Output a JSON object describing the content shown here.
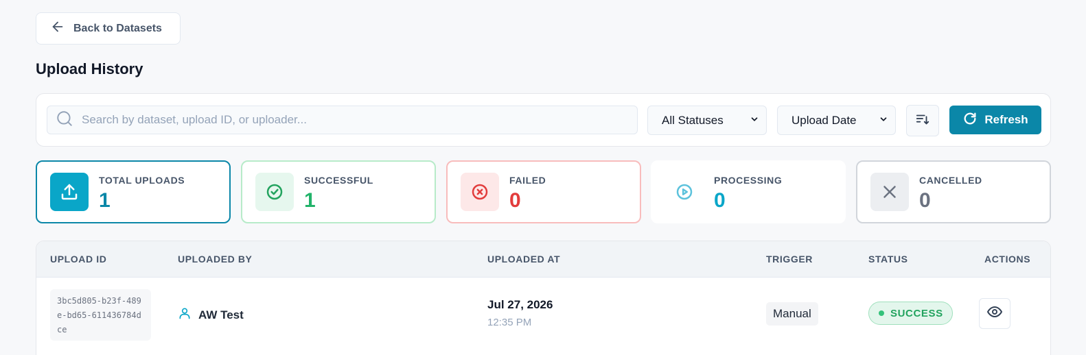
{
  "nav": {
    "back_label": "Back to Datasets"
  },
  "page": {
    "title": "Upload History"
  },
  "filters": {
    "search_placeholder": "Search by dataset, upload ID, or uploader...",
    "status_select": "All Statuses",
    "sort_select": "Upload Date",
    "refresh_label": "Refresh"
  },
  "stats": [
    {
      "label": "TOTAL UPLOADS",
      "value": "1",
      "icon": "upload-icon"
    },
    {
      "label": "SUCCESSFUL",
      "value": "1",
      "icon": "check-circle-icon"
    },
    {
      "label": "FAILED",
      "value": "0",
      "icon": "x-circle-icon"
    },
    {
      "label": "PROCESSING",
      "value": "0",
      "icon": "play-circle-icon"
    },
    {
      "label": "CANCELLED",
      "value": "0",
      "icon": "x-icon"
    }
  ],
  "table": {
    "headers": {
      "upload_id": "UPLOAD ID",
      "uploaded_by": "UPLOADED BY",
      "uploaded_at": "UPLOADED AT",
      "trigger": "TRIGGER",
      "status": "STATUS",
      "actions": "ACTIONS"
    },
    "rows": [
      {
        "upload_id": "3bc5d805-b23f-489e-bd65-611436784dce",
        "uploaded_by": "AW Test",
        "date": "Jul 27, 2026",
        "time": "12:35 PM",
        "trigger": "Manual",
        "status": "SUCCESS"
      }
    ]
  },
  "colors": {
    "accent": "#0b87a8",
    "success": "#22b36a",
    "failed": "#e23c3c",
    "processing": "#0aa6c8",
    "cancelled": "#6b7280"
  }
}
